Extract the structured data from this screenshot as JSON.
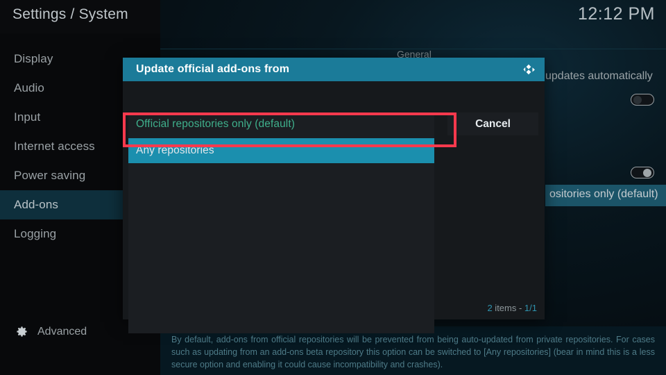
{
  "header": {
    "title": "Settings / System",
    "clock": "12:12 PM"
  },
  "sidebar": {
    "items": [
      {
        "label": "Display",
        "active": false
      },
      {
        "label": "Audio",
        "active": false
      },
      {
        "label": "Input",
        "active": false
      },
      {
        "label": "Internet access",
        "active": false
      },
      {
        "label": "Power saving",
        "active": false
      },
      {
        "label": "Add-ons",
        "active": true
      },
      {
        "label": "Logging",
        "active": false
      }
    ],
    "advanced_label": "Advanced",
    "advanced_icon": "gear-icon"
  },
  "background_panel": {
    "group_label": "General",
    "rows": [
      {
        "label": "updates automatically",
        "toggle": "off"
      },
      {
        "label": "ositories only (default)"
      }
    ],
    "toggle_states": [
      "off",
      "on"
    ]
  },
  "dialog": {
    "title": "Update official add-ons from",
    "logo_icon": "kodi-logo-icon",
    "options": [
      {
        "label": "Official repositories only (default)",
        "state": "current"
      },
      {
        "label": "Any repositories",
        "state": "focused"
      }
    ],
    "cancel_label": "Cancel",
    "item_count_prefix": "2",
    "item_count_word": " items - ",
    "item_count_page": "1/1"
  },
  "description": {
    "text": "By default, add-ons from official repositories will be prevented from being auto-updated from private repositories. For cases such as updating from an add-ons beta repository this option can be switched to [Any repositories] (bear in mind this is a less secure option and enabling it could cause incompatibility and crashes)."
  },
  "colors": {
    "accent": "#1b8fae",
    "header_bar": "#1b7b99",
    "highlight_red": "#f9394d",
    "current_green": "#3fb08c",
    "desc_text": "#4e7b88"
  }
}
